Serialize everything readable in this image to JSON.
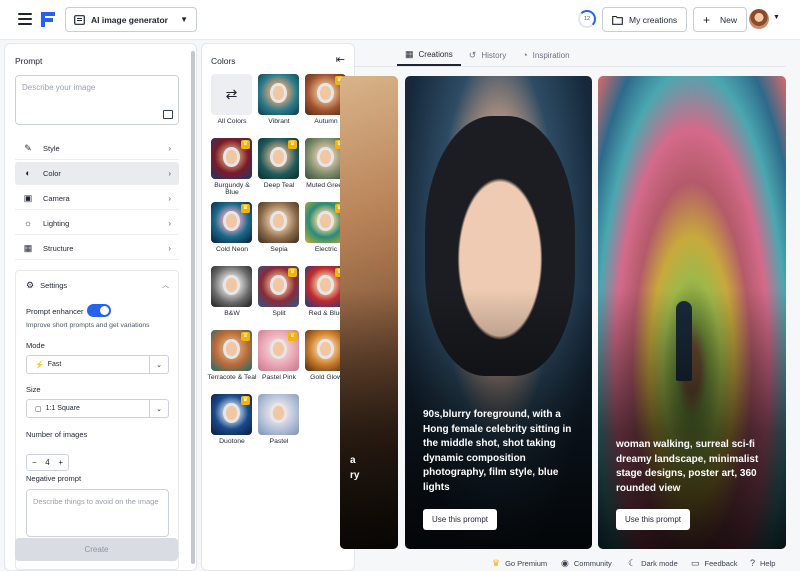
{
  "topbar": {
    "tool_select": "AI image generator",
    "credits": "12",
    "my_creations": "My creations",
    "new": "New"
  },
  "prompt_panel": {
    "title": "Prompt",
    "placeholder": "Describe your image",
    "accordions": [
      {
        "label": "Style",
        "icon": "style-icon"
      },
      {
        "label": "Color",
        "icon": "palette-icon"
      },
      {
        "label": "Camera",
        "icon": "camera-icon"
      },
      {
        "label": "Lighting",
        "icon": "lighting-icon"
      },
      {
        "label": "Structure",
        "icon": "structure-icon"
      }
    ],
    "settings": {
      "title": "Settings",
      "enhancer_label": "Prompt enhancer",
      "enhancer_on": true,
      "enhancer_desc": "Improve short prompts and get variations",
      "mode_label": "Mode",
      "mode_value": "Fast",
      "size_label": "Size",
      "size_value": "1:1 Square",
      "count_label": "Number of images",
      "count_minus": "−",
      "count_value": "4",
      "count_plus": "+",
      "negative_label": "Negative prompt",
      "negative_placeholder": "Describe things to avoid on the image"
    },
    "create": "Create"
  },
  "colors_panel": {
    "title": "Colors",
    "items": [
      {
        "label": "All Colors",
        "premium": false
      },
      {
        "label": "Vibrant",
        "premium": false
      },
      {
        "label": "Autumn",
        "premium": true
      },
      {
        "label": "Burgundy & Blue",
        "premium": true
      },
      {
        "label": "Deep Teal",
        "premium": true
      },
      {
        "label": "Muted Green",
        "premium": true
      },
      {
        "label": "Cold Neon",
        "premium": true
      },
      {
        "label": "Sepia",
        "premium": false
      },
      {
        "label": "Electric",
        "premium": true
      },
      {
        "label": "B&W",
        "premium": false
      },
      {
        "label": "Split",
        "premium": true
      },
      {
        "label": "Red & Blue",
        "premium": true
      },
      {
        "label": "Terracote & Teal",
        "premium": true
      },
      {
        "label": "Pastel Pink",
        "premium": true
      },
      {
        "label": "Gold Glow",
        "premium": false
      },
      {
        "label": "Duotone",
        "premium": true
      },
      {
        "label": "Pastel",
        "premium": false
      }
    ]
  },
  "tabs": [
    {
      "label": "Creations",
      "active": true
    },
    {
      "label": "History",
      "active": false
    },
    {
      "label": "Inspiration",
      "active": false
    }
  ],
  "cards": [
    {
      "caption": "a\nry",
      "button": ""
    },
    {
      "caption": "90s,blurry foreground, with a Hong female celebrity sitting in the middle shot, shot taking dynamic composition photography, film style, blue lights",
      "button": "Use this prompt"
    },
    {
      "caption": "woman walking, surreal sci-fi dreamy landscape, minimalist stage designs, poster art, 360 rounded view",
      "button": "Use this prompt"
    }
  ],
  "footer": {
    "premium": "Go Premium",
    "community": "Community",
    "dark_mode": "Dark mode",
    "feedback": "Feedback",
    "help": "Help"
  },
  "colors": {
    "accent": "#2563eb",
    "premium_badge": "#f4b400"
  }
}
